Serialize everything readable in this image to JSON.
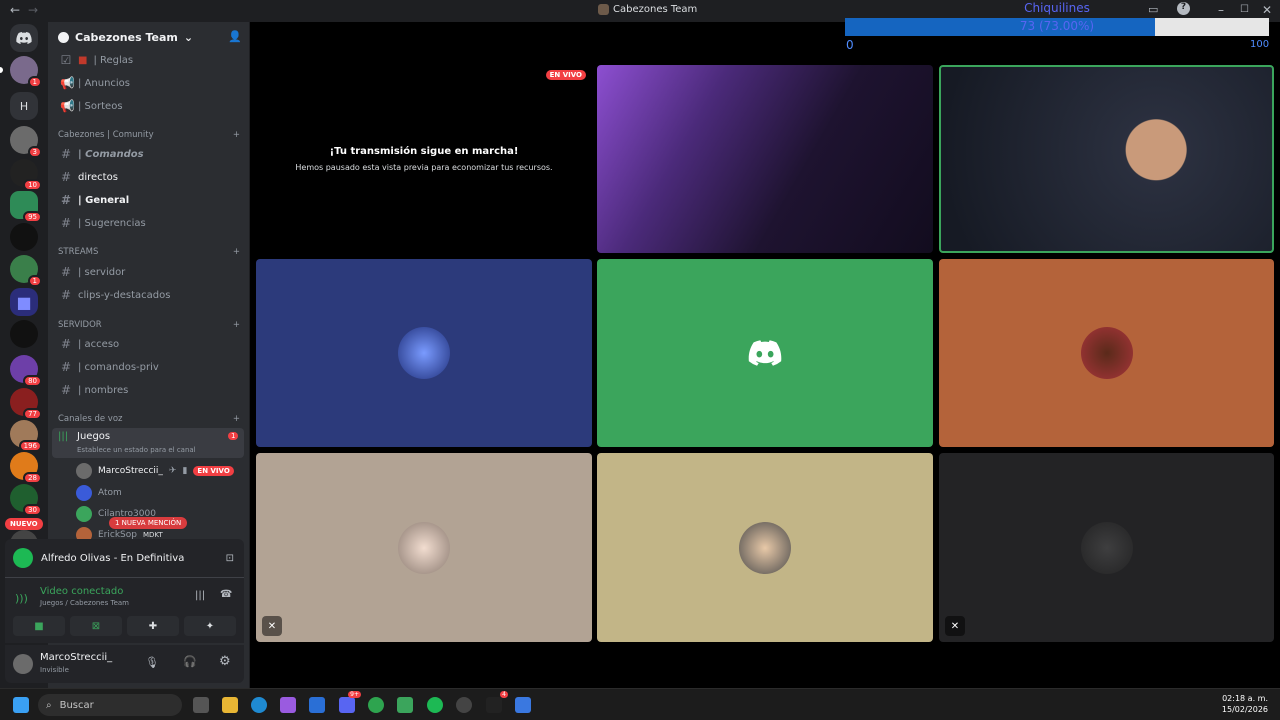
{
  "window": {
    "title": "Cabezones Team",
    "back_icon": "arrow-left-icon",
    "forward_icon": "arrow-right-icon"
  },
  "overlay": {
    "label": "Chiquilines",
    "progress_text": "73 (73.00%)",
    "progress": 0.73,
    "min": "0",
    "max": "100",
    "fill_color": "#1565c0"
  },
  "rail_badges": [
    "1",
    "3",
    "10",
    "95",
    "1",
    "80",
    "77",
    "196",
    "28",
    "30",
    "272"
  ],
  "rail_new_label": "NUEVO",
  "server": {
    "name": "Cabezones Team",
    "channels_top": [
      {
        "label": "| Reglas",
        "icon": "checkbox-icon"
      },
      {
        "label": "| Anuncios",
        "icon": "megaphone-icon"
      },
      {
        "label": "| Sorteos",
        "icon": "megaphone-icon"
      }
    ],
    "cat_comunity": "Cabezones  |  Comunity",
    "channels_comunity": [
      {
        "label": "| Comandos"
      },
      {
        "label": "directos"
      },
      {
        "label": "| General"
      },
      {
        "label": "| Sugerencias"
      }
    ],
    "cat_streams": "STREAMS",
    "channels_streams": [
      {
        "label": "| servidor"
      },
      {
        "label": "clips-y-destacados"
      }
    ],
    "cat_servidor": "SERVIDOR",
    "channels_servidor": [
      {
        "label": "| acceso"
      },
      {
        "label": "| comandos-priv"
      },
      {
        "label": "| nombres"
      }
    ],
    "cat_voice": "Canales de voz",
    "voice_channel": {
      "name": "Juegos",
      "badge": "1",
      "status": "Establece un estado para el canal"
    },
    "members": [
      {
        "name": "MarcoStreccii_",
        "live": "EN VIVO"
      },
      {
        "name": "Atom"
      },
      {
        "name": "Cilantro3000"
      },
      {
        "name": "ErickSop",
        "tag": "MDKT"
      }
    ],
    "mention_label": "1 NUEVA MENCIÓN"
  },
  "spotify": {
    "track": "Alfredo Olivas - En Definitiva"
  },
  "voice_panel": {
    "status": "Video conectado",
    "location": "Juegos / Cabezones Team"
  },
  "user": {
    "name": "MarcoStreccii_",
    "status": "Invisible"
  },
  "stream_tile": {
    "live": "EN VIVO",
    "heading": "¡Tu transmisión sigue en marcha!",
    "sub": "Hemos pausado esta vista previa para economizar tus recursos."
  },
  "tile_colors": {
    "t1": "#2c3a7b",
    "t2": "#3ba55c",
    "t3": "#b4633a",
    "t4": "#b2a394",
    "t5": "#c2b587",
    "t6": "#232325"
  },
  "taskbar": {
    "search": "Buscar",
    "time": "02:18 a. m.",
    "date": "15/02/2026",
    "badges": [
      "9+",
      "4"
    ]
  }
}
